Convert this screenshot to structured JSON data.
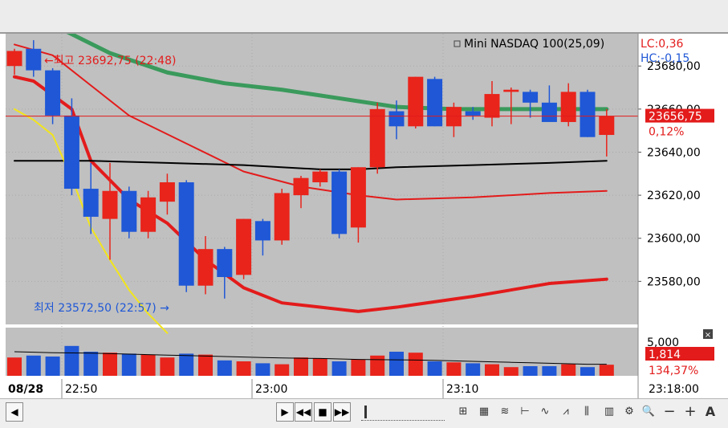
{
  "legend": {
    "instrument": "Mini NASDAQ 100(25,09)",
    "lc": "LC:0,36",
    "hc": "HC:-0,15"
  },
  "annotations": {
    "high": "←최고 23692,75 (22:48)",
    "low": "최저 23572,50 (22:57) →"
  },
  "current": {
    "price": "23656,75",
    "change_pct": "0,12%"
  },
  "volume_panel": {
    "scale": "5,000",
    "current": "1,814",
    "ratio": "134,37%"
  },
  "time_axis": {
    "date": "08/28",
    "labels": [
      "22:50",
      "23:00",
      "23:10",
      "23:18:00"
    ]
  },
  "colors": {
    "up": "#e8241b",
    "down": "#1f57d6",
    "ma_green": "#3a9a5c",
    "ma_red": "#e31b1b",
    "ma_black": "#000000",
    "ma_yellow": "#f2e51b",
    "plot_bg": "#c0c0c0"
  },
  "toolbar": {
    "icons": [
      "play-icon",
      "rewind-icon",
      "stop-icon",
      "fast-forward-icon",
      "zoom-out-icon",
      "zoom-in-icon",
      "auto-scale-icon"
    ],
    "minus_label": "−",
    "plus_label": "+",
    "auto_label": "A"
  },
  "chart_data": {
    "type": "candlestick",
    "price_axis": {
      "ylim": [
        23560,
        23695
      ],
      "ticks": [
        "23680,00",
        "23660,00",
        "23640,00",
        "23620,00",
        "23600,00",
        "23580,00"
      ]
    },
    "volume_axis": {
      "ylim": [
        0,
        5000
      ]
    },
    "candles": [
      {
        "o": 23680,
        "h": 23688,
        "l": 23676,
        "c": 23687
      },
      {
        "o": 23688,
        "h": 23692,
        "l": 23675,
        "c": 23678
      },
      {
        "o": 23678,
        "h": 23679,
        "l": 23653,
        "c": 23657
      },
      {
        "o": 23657,
        "h": 23665,
        "l": 23620,
        "c": 23623
      },
      {
        "o": 23623,
        "h": 23635,
        "l": 23602,
        "c": 23610
      },
      {
        "o": 23609,
        "h": 23635,
        "l": 23590,
        "c": 23622
      },
      {
        "o": 23622,
        "h": 23624,
        "l": 23600,
        "c": 23603
      },
      {
        "o": 23603,
        "h": 23622,
        "l": 23600,
        "c": 23619
      },
      {
        "o": 23617,
        "h": 23630,
        "l": 23611,
        "c": 23626
      },
      {
        "o": 23626,
        "h": 23627,
        "l": 23575,
        "c": 23578
      },
      {
        "o": 23578,
        "h": 23601,
        "l": 23574,
        "c": 23595
      },
      {
        "o": 23595,
        "h": 23596,
        "l": 23572,
        "c": 23582
      },
      {
        "o": 23583,
        "h": 23609,
        "l": 23581,
        "c": 23609
      },
      {
        "o": 23608,
        "h": 23609,
        "l": 23592,
        "c": 23599
      },
      {
        "o": 23599,
        "h": 23623,
        "l": 23597,
        "c": 23621
      },
      {
        "o": 23620,
        "h": 23629,
        "l": 23614,
        "c": 23628
      },
      {
        "o": 23626,
        "h": 23632,
        "l": 23624,
        "c": 23631
      },
      {
        "o": 23631,
        "h": 23632,
        "l": 23600,
        "c": 23602
      },
      {
        "o": 23605,
        "h": 23633,
        "l": 23598,
        "c": 23633
      },
      {
        "o": 23633,
        "h": 23663,
        "l": 23630,
        "c": 23660
      },
      {
        "o": 23659,
        "h": 23664,
        "l": 23646,
        "c": 23652
      },
      {
        "o": 23652,
        "h": 23675,
        "l": 23651,
        "c": 23675
      },
      {
        "o": 23674,
        "h": 23675,
        "l": 23652,
        "c": 23652
      },
      {
        "o": 23652,
        "h": 23663,
        "l": 23647,
        "c": 23661
      },
      {
        "o": 23659,
        "h": 23661,
        "l": 23655,
        "c": 23657
      },
      {
        "o": 23656,
        "h": 23673,
        "l": 23652,
        "c": 23667
      },
      {
        "o": 23668,
        "h": 23670,
        "l": 23653,
        "c": 23669
      },
      {
        "o": 23668,
        "h": 23669,
        "l": 23656,
        "c": 23663
      },
      {
        "o": 23663,
        "h": 23671,
        "l": 23655,
        "c": 23654
      },
      {
        "o": 23654,
        "h": 23672,
        "l": 23652,
        "c": 23668
      },
      {
        "o": 23668,
        "h": 23669,
        "l": 23647,
        "c": 23647
      },
      {
        "o": 23648,
        "h": 23660,
        "l": 23638,
        "c": 23656.75
      }
    ],
    "volume": [
      1900,
      2100,
      2000,
      3100,
      2500,
      2400,
      2300,
      2200,
      1900,
      2300,
      2200,
      1600,
      1500,
      1300,
      1200,
      1900,
      1800,
      1500,
      1700,
      2100,
      2500,
      2400,
      1500,
      1400,
      1300,
      1200,
      900,
      1000,
      1000,
      1200,
      900,
      1150
    ],
    "ma_lines": [
      {
        "color": "green",
        "points": [
          [
            2.5,
            23697
          ],
          [
            5,
            23686
          ],
          [
            8,
            23677
          ],
          [
            11,
            23672
          ],
          [
            14,
            23669
          ],
          [
            17,
            23665
          ],
          [
            20,
            23661
          ],
          [
            23,
            23660
          ],
          [
            26,
            23660
          ],
          [
            29,
            23660
          ],
          [
            31,
            23660
          ]
        ]
      },
      {
        "color": "red-thin",
        "points": [
          [
            0,
            23690
          ],
          [
            2,
            23685
          ],
          [
            4,
            23671
          ],
          [
            6,
            23657
          ],
          [
            9,
            23644
          ],
          [
            12,
            23631
          ],
          [
            15,
            23624
          ],
          [
            18,
            23620
          ],
          [
            20,
            23618
          ],
          [
            24,
            23619
          ],
          [
            28,
            23621
          ],
          [
            31,
            23622
          ]
        ]
      },
      {
        "color": "red-thick",
        "points": [
          [
            0,
            23675
          ],
          [
            1,
            23673
          ],
          [
            3,
            23660
          ],
          [
            4,
            23636
          ],
          [
            6,
            23618
          ],
          [
            8,
            23607
          ],
          [
            10,
            23590
          ],
          [
            12,
            23577
          ],
          [
            14,
            23570
          ],
          [
            16,
            23568
          ],
          [
            18,
            23566
          ],
          [
            20,
            23568
          ],
          [
            24,
            23573
          ],
          [
            28,
            23579
          ],
          [
            31,
            23581
          ]
        ]
      },
      {
        "color": "black",
        "points": [
          [
            0,
            23636
          ],
          [
            4,
            23636
          ],
          [
            8,
            23635
          ],
          [
            12,
            23634
          ],
          [
            16,
            23632
          ],
          [
            18,
            23632
          ],
          [
            20,
            23633
          ],
          [
            24,
            23634
          ],
          [
            28,
            23635
          ],
          [
            31,
            23636
          ]
        ]
      },
      {
        "color": "yellow",
        "points": [
          [
            0,
            23660
          ],
          [
            1,
            23655
          ],
          [
            2,
            23648
          ],
          [
            3,
            23628
          ],
          [
            4,
            23605
          ],
          [
            5,
            23590
          ],
          [
            6,
            23576
          ],
          [
            7,
            23565
          ],
          [
            8,
            23556
          ]
        ]
      }
    ],
    "volume_ma": [
      2500,
      2450,
      2400,
      2380,
      2350,
      2300,
      2250,
      2200,
      2150,
      2100,
      2050,
      2000,
      1950,
      1900,
      1850,
      1820,
      1800,
      1750,
      1700,
      1680,
      1660,
      1640,
      1600,
      1550,
      1500,
      1450,
      1400,
      1350,
      1300,
      1250,
      1200,
      1200
    ],
    "reference_price": 23656.75
  }
}
